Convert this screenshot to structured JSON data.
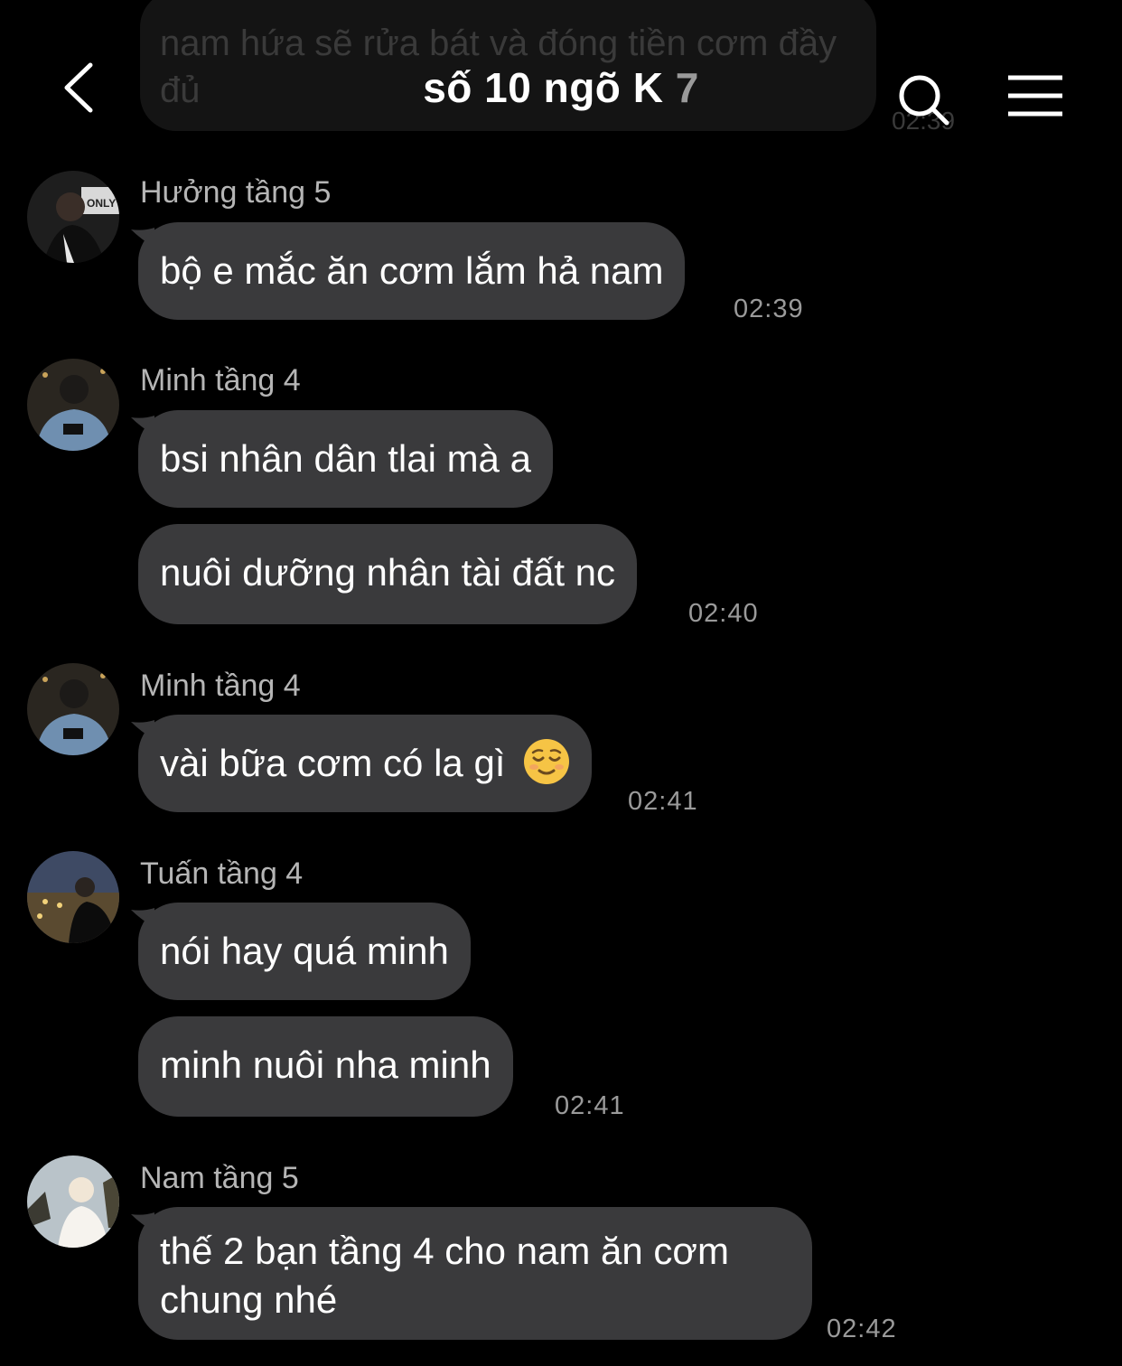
{
  "header": {
    "title_main": "số 10 ngõ K",
    "title_count": "7"
  },
  "ghost_message": {
    "text": "nam hứa sẽ rửa bát và đóng tiền cơm đầy đủ",
    "time": "02:39"
  },
  "messages": [
    {
      "sender": "Hưởng tầng 5",
      "avatar": "avatar-huong",
      "texts": [
        "bộ e mắc ăn cơm lắm hả nam"
      ],
      "time": "02:39"
    },
    {
      "sender": "Minh tầng 4",
      "avatar": "avatar-minh",
      "texts": [
        "bsi nhân dân tlai mà a",
        "nuôi dưỡng nhân tài đất nc"
      ],
      "time": "02:40"
    },
    {
      "sender": "Minh tầng 4",
      "avatar": "avatar-minh",
      "texts": [
        "vài bữa cơm có la gì"
      ],
      "emoji": "relieved-face-emoji",
      "time": "02:41"
    },
    {
      "sender": "Tuấn tầng 4",
      "avatar": "avatar-tuan",
      "texts": [
        "nói hay quá minh",
        "minh nuôi nha minh"
      ],
      "time": "02:41"
    },
    {
      "sender": "Nam tầng 5",
      "avatar": "avatar-nam",
      "texts": [
        "thế 2 bạn tầng 4 cho nam ăn cơm chung nhé"
      ],
      "time": "02:42"
    }
  ],
  "icons": {
    "back": "chevron-left-icon",
    "search": "search-icon",
    "menu": "hamburger-menu-icon"
  },
  "colors": {
    "background": "#000000",
    "bubble": "#3a3a3c",
    "sender_text": "#b5b5b5",
    "time_text": "#9a9a9a"
  }
}
